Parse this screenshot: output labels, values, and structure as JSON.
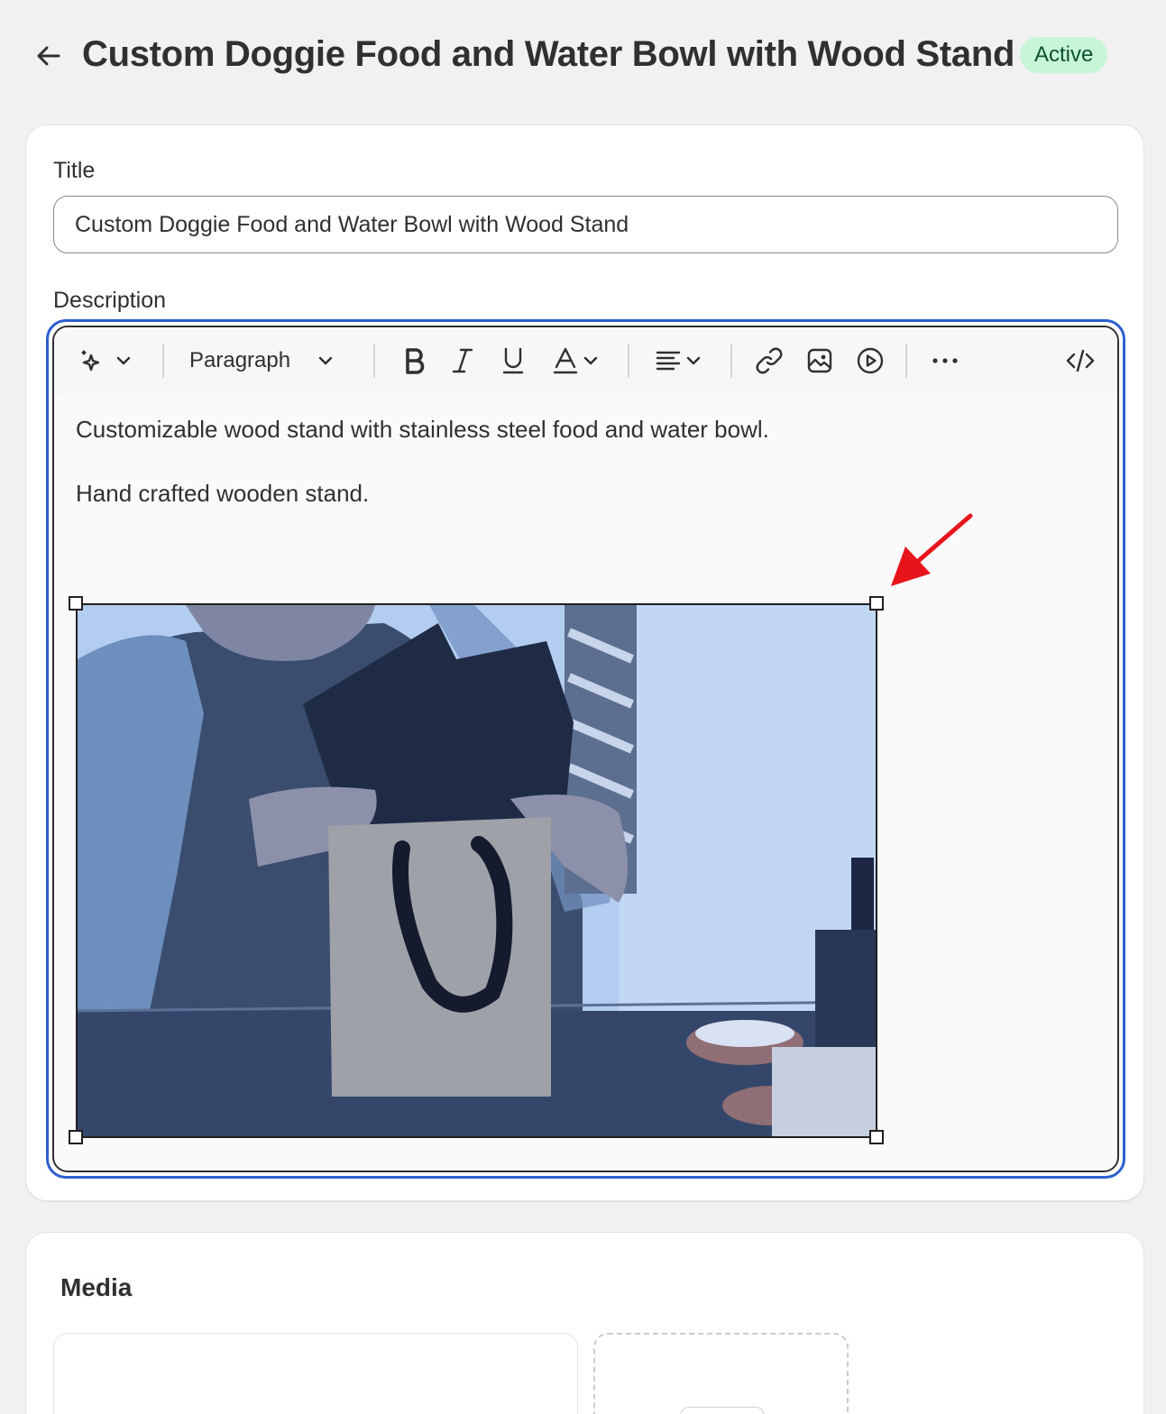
{
  "header": {
    "back_icon": "arrow-left-icon",
    "title": "Custom Doggie Food and Water Bowl with Wood Stand",
    "status": "Active",
    "status_color": "#c6f6d5"
  },
  "title_field": {
    "label": "Title",
    "value": "Custom Doggie Food and Water Bowl with Wood Stand"
  },
  "description": {
    "label": "Description",
    "toolbar": {
      "ai_icon": "magic-sparkle-icon",
      "format_select": "Paragraph",
      "bold_icon": "bold-icon",
      "italic_icon": "italic-icon",
      "underline_icon": "underline-icon",
      "text_color_icon": "text-color-icon",
      "align_icon": "align-left-icon",
      "link_icon": "link-icon",
      "image_icon": "image-icon",
      "video_icon": "video-play-icon",
      "more_icon": "more-horizontal-icon",
      "html_icon": "code-icon"
    },
    "paragraphs": [
      "Customizable wood stand with stainless steel food and water bowl.",
      "Hand crafted wooden stand."
    ],
    "image": {
      "state": "selected",
      "subject": "woman holding kraft paper gift bag with tissue paper"
    }
  },
  "annotation": {
    "type": "arrow",
    "color": "#e8141c",
    "points_to": "image top-right resize handle"
  },
  "media": {
    "title": "Media"
  },
  "colors": {
    "focus_ring": "#2b5fd0",
    "page_bg": "#f1f1f1",
    "card_bg": "#ffffff"
  }
}
